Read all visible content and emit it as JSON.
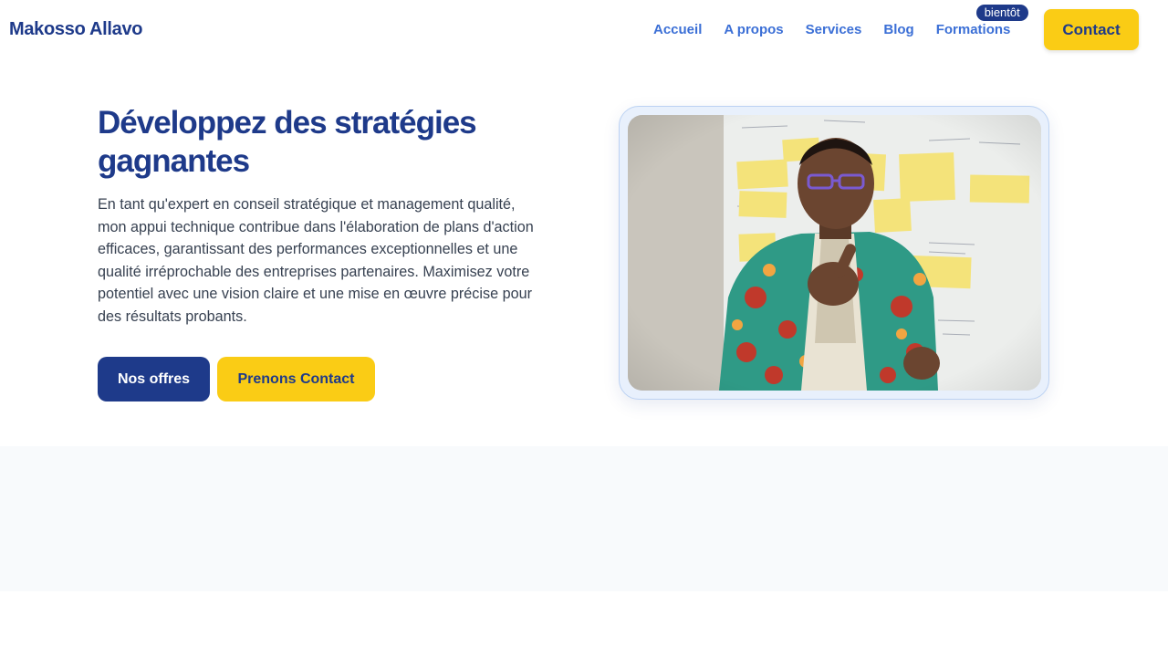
{
  "header": {
    "brand": "Makosso Allavo",
    "nav": [
      {
        "label": "Accueil"
      },
      {
        "label": "A propos"
      },
      {
        "label": "Services"
      },
      {
        "label": "Blog"
      },
      {
        "label": "Formations",
        "badge": "bientôt"
      }
    ],
    "contact_label": "Contact"
  },
  "hero": {
    "title": "Développez des stratégies gagnantes",
    "text": "En tant qu'expert en conseil stratégique et management qualité, mon appui technique contribue dans l'élaboration de plans d'action efficaces, garantissant des performances exceptionnelles et une qualité irréprochable des entreprises partenaires. Maximisez votre potentiel avec une vision claire et une mise en œuvre précise pour des résultats probants.",
    "primary_button": "Nos offres",
    "secondary_button": "Prenons Contact",
    "photo_icon": "portrait-photo"
  },
  "colors": {
    "brand_blue": "#1e3a8a",
    "nav_blue": "#3b6fd6",
    "accent_yellow": "#facc15",
    "band_gray": "#f8fafc"
  }
}
